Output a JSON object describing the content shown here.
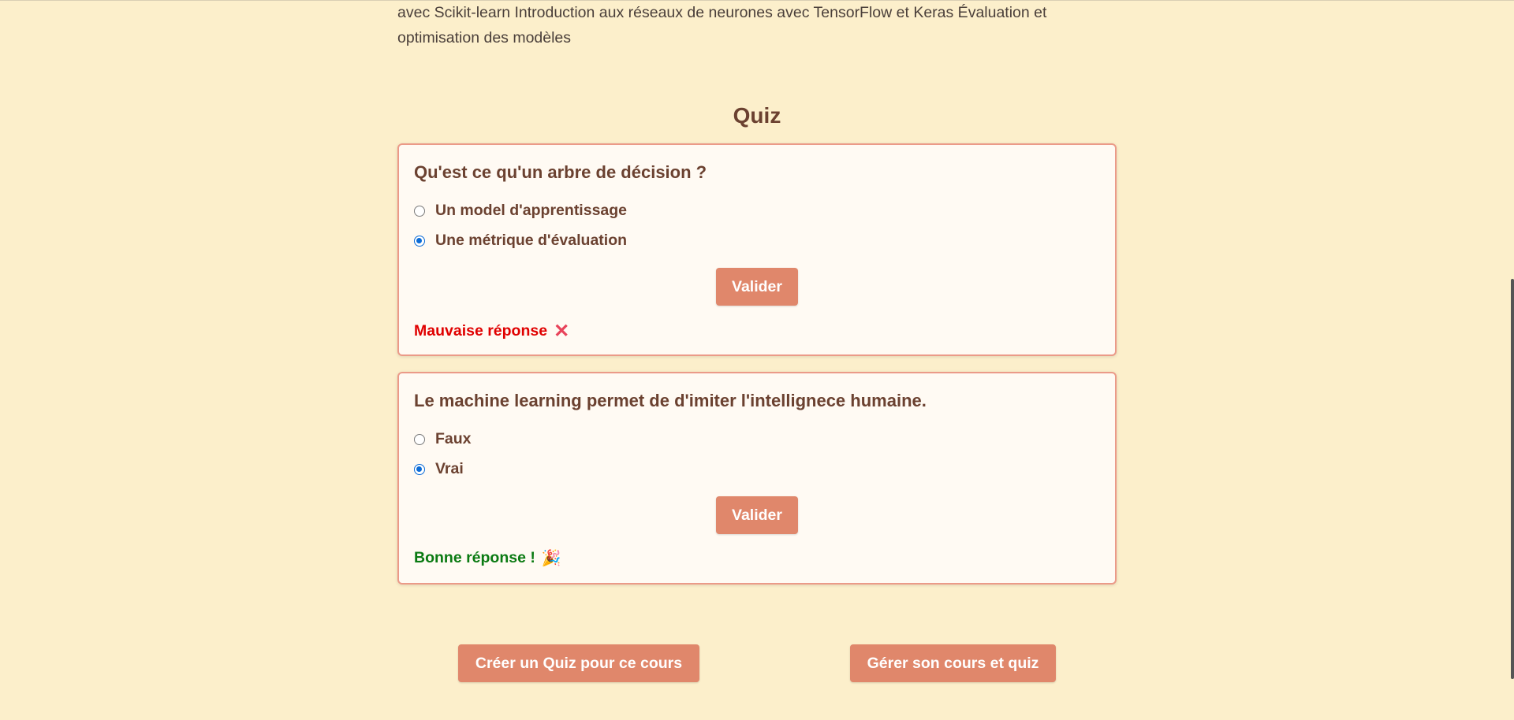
{
  "course": {
    "description_line1": "avec Scikit-learn Introduction aux réseaux de neurones avec TensorFlow et Keras Évaluation et",
    "description_line2": "optimisation des modèles"
  },
  "quiz": {
    "title": "Quiz",
    "questions": [
      {
        "question": "Qu'est ce qu'un arbre de décision ?",
        "options": [
          {
            "label": "Un model d'apprentissage",
            "selected": false
          },
          {
            "label": "Une métrique d'évaluation",
            "selected": true
          }
        ],
        "validate_label": "Valider",
        "feedback": "Mauvaise réponse",
        "feedback_icon": "cross-mark-icon",
        "feedback_color": "#e00000"
      },
      {
        "question": "Le machine learning permet de d'imiter l'intellignece humaine.",
        "options": [
          {
            "label": "Faux",
            "selected": false
          },
          {
            "label": "Vrai",
            "selected": true
          }
        ],
        "validate_label": "Valider",
        "feedback": "Bonne réponse !",
        "feedback_icon": "party-popper-icon",
        "feedback_color": "#0a7a12"
      }
    ]
  },
  "actions": {
    "create_quiz_label": "Créer un Quiz pour ce cours",
    "manage_label": "Gérer son cours et quiz"
  },
  "colors": {
    "background": "#fcefcb",
    "accent": "#e0876b",
    "card_border": "#eb9a88",
    "heading": "#6b4130"
  }
}
